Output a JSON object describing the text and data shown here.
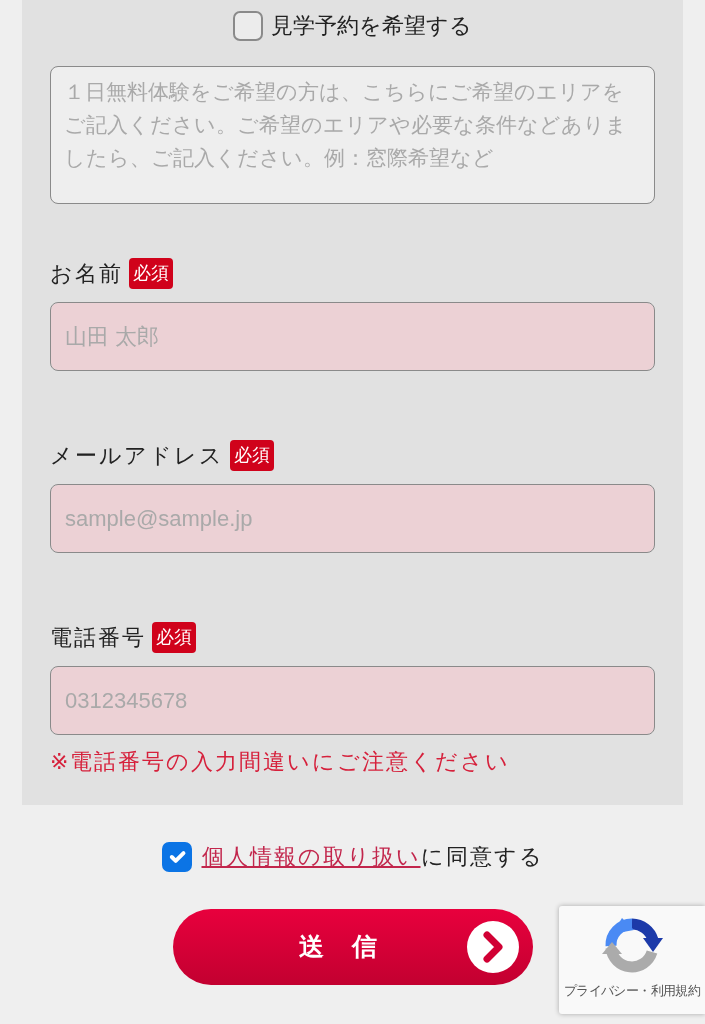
{
  "visit_request": {
    "label": "見学予約を希望する",
    "checked": false
  },
  "request_note": {
    "placeholder": "１日無料体験をご希望の方は、こちらにご希望のエリアをご記入ください。ご希望のエリアや必要な条件などありましたら、ご記入ください。例：窓際希望など"
  },
  "fields": [
    {
      "label": "お名前",
      "badge": "必須",
      "placeholder": "山田 太郎"
    },
    {
      "label": "メールアドレス",
      "badge": "必須",
      "placeholder": "sample@sample.jp"
    },
    {
      "label": "電話番号",
      "badge": "必須",
      "placeholder": "0312345678",
      "note": "※電話番号の入力間違いにご注意ください"
    }
  ],
  "consent": {
    "checked": true,
    "link": "個人情報の取り扱い",
    "text": "に同意する"
  },
  "submit_button": {
    "label": "送信"
  },
  "recaptcha": {
    "text": "プライバシー・利用規約"
  }
}
